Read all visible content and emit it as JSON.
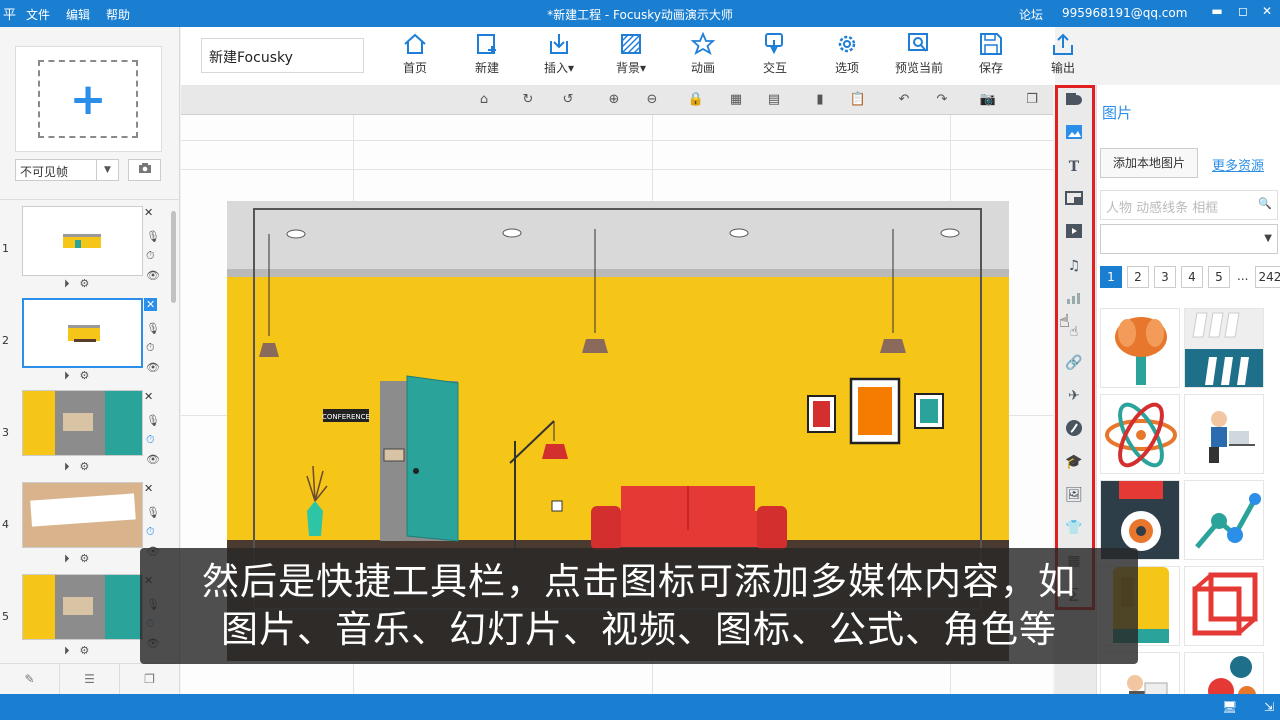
{
  "titlebar": {
    "logo": "平",
    "menu": [
      "文件",
      "编辑",
      "帮助"
    ],
    "title": "*新建工程 - Focusky动画演示大师",
    "forum": "论坛",
    "account": "995968191@qq.com",
    "min": "▬",
    "max": "◻",
    "close": "✕"
  },
  "left": {
    "add_frame_plus": "+",
    "frame_filter": "不可见帧",
    "filter_arrow": "▼",
    "camera_icon": "camera-icon",
    "thumbnails": [
      {
        "num": "1"
      },
      {
        "num": "2"
      },
      {
        "num": "3"
      },
      {
        "num": "4"
      },
      {
        "num": "5"
      }
    ],
    "close_x": "✕",
    "bottom_icons": [
      "edit-icon",
      "list-icon",
      "layers-icon"
    ]
  },
  "toolbar": {
    "project_name": "新建Focusky",
    "tools": [
      {
        "label": "首页",
        "icon": "home-icon"
      },
      {
        "label": "新建",
        "icon": "new-icon"
      },
      {
        "label": "插入▾",
        "icon": "insert-icon"
      },
      {
        "label": "背景▾",
        "icon": "background-icon"
      },
      {
        "label": "动画",
        "icon": "animation-icon"
      },
      {
        "label": "交互",
        "icon": "interaction-icon"
      },
      {
        "label": "选项",
        "icon": "options-icon"
      },
      {
        "label": "预览当前",
        "icon": "preview-icon"
      },
      {
        "label": "保存",
        "icon": "save-icon"
      },
      {
        "label": "输出",
        "icon": "export-icon"
      }
    ]
  },
  "canvas_tools": [
    "home",
    "redo-alt",
    "undo-alt",
    "zoom-in",
    "zoom-out",
    "lock",
    "grid",
    "grid-off",
    "layer-up",
    "paste",
    "undo",
    "redo",
    "camera",
    "window"
  ],
  "right": {
    "title": "图片",
    "add_local": "添加本地图片",
    "more": "更多资源",
    "search_placeholder": "人物 动感线条 相框",
    "pages": [
      "1",
      "2",
      "3",
      "4",
      "5",
      "...",
      "242"
    ]
  },
  "quickbar_icons": [
    "shape-icon",
    "image-icon",
    "text-icon",
    "frame-icon",
    "video-icon",
    "music-icon",
    "chart-icon",
    "pointer-icon",
    "link-icon",
    "plane-icon",
    "flash-icon",
    "hat-icon",
    "gallery-icon",
    "shirt-icon",
    "grid-icon",
    "formula-icon"
  ],
  "subtitle": {
    "line1": "然后是快捷工具栏，点击图标可添加多媒体内容，如",
    "line2": "图片、音乐、幻灯片、视频、图标、公式、角色等"
  },
  "canvas": {
    "door_sign": "CONFERENCE"
  },
  "colors": {
    "accent": "#1b7fd1",
    "wall_yellow": "#f5c518",
    "highlight_red": "#e02020"
  }
}
